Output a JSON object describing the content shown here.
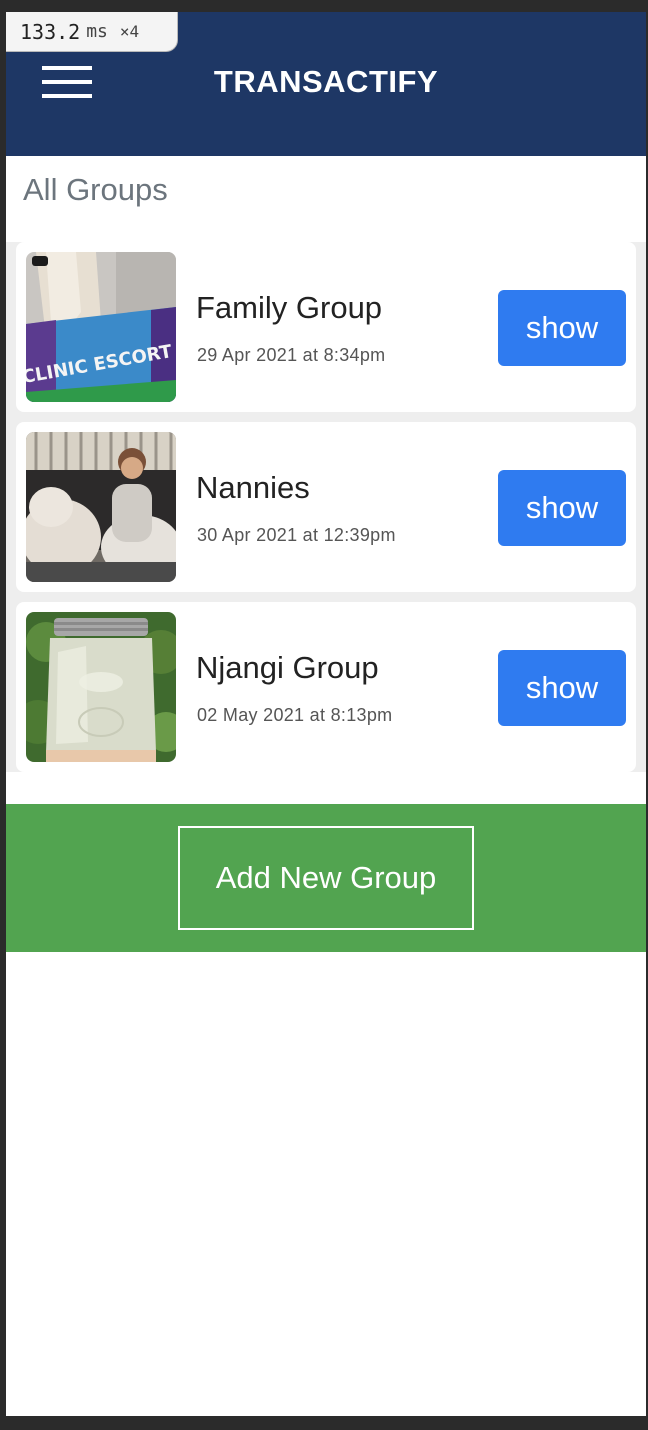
{
  "perf_badge": {
    "ms_value": "133.2",
    "ms_unit": "ms",
    "multiplier": "×4"
  },
  "navbar": {
    "brand": "TRANSACTIFY",
    "menu_icon": "hamburger-menu-icon",
    "background_color": "#1e3765"
  },
  "page": {
    "heading": "All Groups"
  },
  "groups": [
    {
      "name": "Family Group",
      "date": "29 Apr 2021 at 8:34pm",
      "show_label": "show"
    },
    {
      "name": "Nannies",
      "date": "30 Apr 2021 at 12:39pm",
      "show_label": "show"
    },
    {
      "name": "Njangi Group",
      "date": "02 May 2021 at 8:13pm",
      "show_label": "show"
    }
  ],
  "add_group": {
    "label": "Add New Group",
    "section_color": "#52a450"
  },
  "colors": {
    "show_button": "#2f7bf0",
    "heading_text": "#6c757d"
  }
}
